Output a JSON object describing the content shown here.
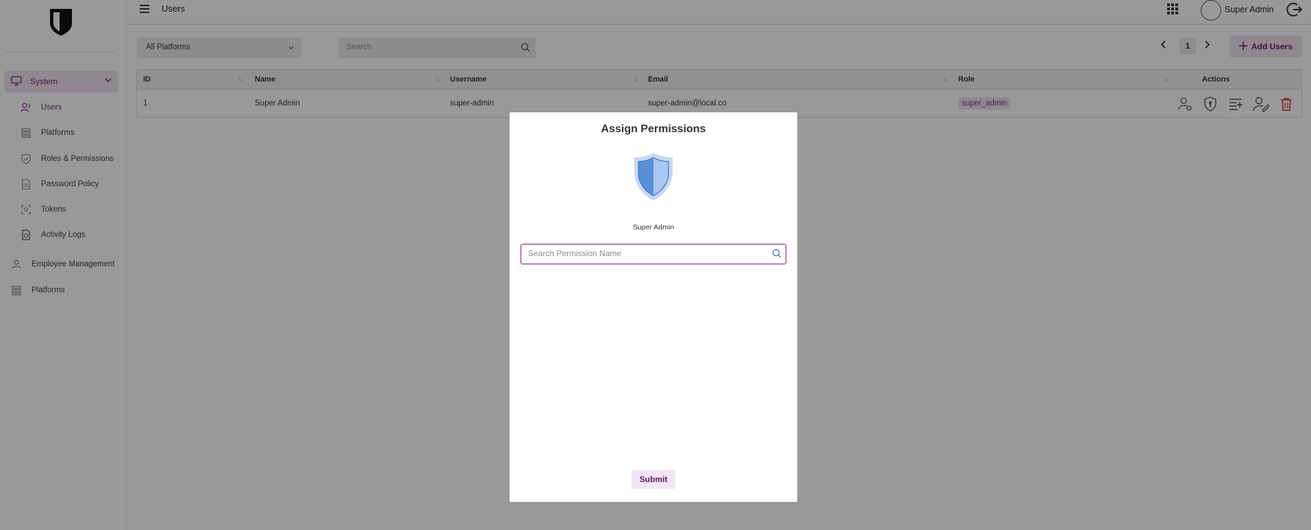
{
  "sidebar": {
    "group": {
      "label": "System",
      "icon": "monitor-icon"
    },
    "items": [
      {
        "label": "Users",
        "icon": "users-icon"
      },
      {
        "label": "Platforms",
        "icon": "list-icon"
      },
      {
        "label": "Roles & Permissions",
        "icon": "shield-icon"
      },
      {
        "label": "Password Policy",
        "icon": "document-icon"
      },
      {
        "label": "Tokens",
        "icon": "token-icon"
      },
      {
        "label": "Activity Logs",
        "icon": "log-icon"
      }
    ],
    "extra": [
      {
        "label": "Employee Management",
        "icon": "user-icon"
      },
      {
        "label": "Platforms",
        "icon": "list-icon"
      }
    ]
  },
  "header": {
    "title": "Users",
    "user_name": "Super Admin"
  },
  "filters": {
    "platform_selected": "All Platforms",
    "search_placeholder": "Search"
  },
  "pagination": {
    "current_page": "1"
  },
  "add_users_label": "Add Users",
  "table": {
    "columns": [
      "ID",
      "Name",
      "Username",
      "Email",
      "Role",
      "Actions"
    ],
    "rows": [
      {
        "id": "1",
        "name": "Super Admin",
        "username": "super-admin",
        "email": "super-admin@local.co",
        "role": "super_admin"
      }
    ]
  },
  "modal": {
    "title": "Assign Permissions",
    "user_name": "Super Admin",
    "search_placeholder": "Search Permission Name",
    "submit_label": "Submit"
  },
  "colors": {
    "accent": "#7a1f7a",
    "accent_light": "#efe3ef",
    "danger": "#d0312d",
    "shield_blue": "#5b8fd8"
  }
}
